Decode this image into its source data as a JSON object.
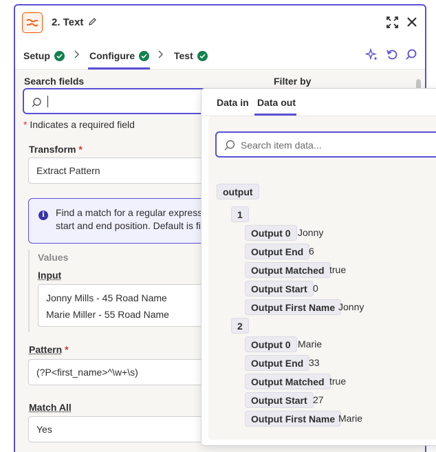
{
  "header": {
    "title": "2. Text",
    "brand_color": "#ff4f00",
    "accent_color": "#5a4fd6"
  },
  "steps": [
    {
      "label": "Setup",
      "status": "complete"
    },
    {
      "label": "Configure",
      "status": "complete"
    },
    {
      "label": "Test",
      "status": "complete"
    }
  ],
  "form": {
    "search_fields_label": "Search fields",
    "filter_by_label": "Filter by",
    "required_note": "Indicates a required field",
    "required_mark": "*",
    "transform_label": "Transform",
    "transform_value": "Extract Pattern",
    "info_line1": "Find a match for a regular expressi",
    "info_line2": "start and end position. Default is fi",
    "values_label": "Values",
    "input_label": "Input",
    "input_line1": "Jonny Mills - 45 Road Name",
    "input_line2": "Marie Miller - 55 Road Name",
    "pattern_label": "Pattern",
    "pattern_value": "(?P<first_name>^\\w+\\s)",
    "match_all_label": "Match All",
    "match_all_value": "Yes"
  },
  "data_panel": {
    "tabs": [
      {
        "label": "Data in",
        "active": false
      },
      {
        "label": "Data out",
        "active": true
      }
    ],
    "search_placeholder": "Search item data...",
    "root_key": "output",
    "items": [
      {
        "index": "1",
        "fields": [
          {
            "key": "Output 0",
            "value": "Jonny"
          },
          {
            "key": "Output End",
            "value": "6"
          },
          {
            "key": "Output Matched",
            "value": "true"
          },
          {
            "key": "Output Start",
            "value": "0"
          },
          {
            "key": "Output First Name",
            "value": "Jonny"
          }
        ]
      },
      {
        "index": "2",
        "fields": [
          {
            "key": "Output 0",
            "value": "Marie"
          },
          {
            "key": "Output End",
            "value": "33"
          },
          {
            "key": "Output Matched",
            "value": "true"
          },
          {
            "key": "Output Start",
            "value": "27"
          },
          {
            "key": "Output First Name",
            "value": "Marie"
          }
        ]
      }
    ]
  }
}
